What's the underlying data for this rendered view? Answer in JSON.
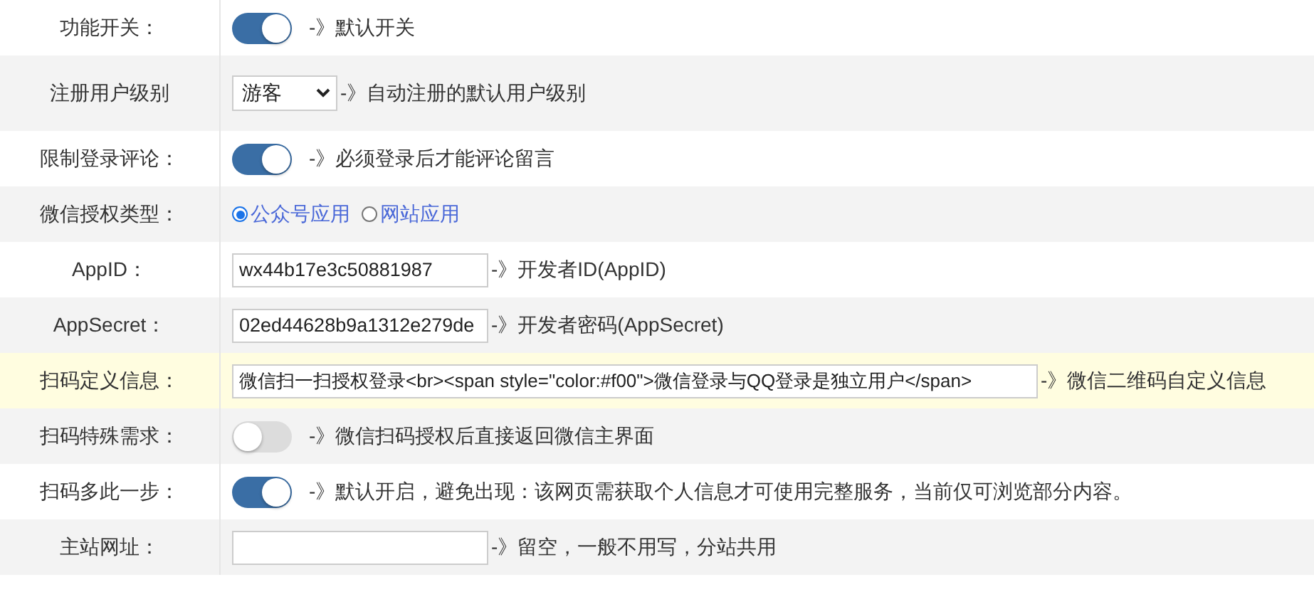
{
  "rows": [
    {
      "label": "功能开关：",
      "kind": "toggle",
      "on": true,
      "hint": "-》默认开关",
      "highlighted": false
    },
    {
      "label": "注册用户级别",
      "kind": "select",
      "value": "游客",
      "hint": "-》自动注册的默认用户级别",
      "highlighted": false
    },
    {
      "label": "限制登录评论：",
      "kind": "toggle",
      "on": true,
      "hint": "-》必须登录后才能评论留言",
      "highlighted": false
    },
    {
      "label": "微信授权类型：",
      "kind": "radio",
      "options": [
        {
          "label": "公众号应用",
          "selected": true
        },
        {
          "label": "网站应用",
          "selected": false
        }
      ],
      "highlighted": false
    },
    {
      "label": "AppID：",
      "kind": "text",
      "value": "wx44b17e3c50881987",
      "hint": "-》开发者ID(AppID)",
      "highlighted": false
    },
    {
      "label": "AppSecret：",
      "kind": "text",
      "value": "02ed44628b9a1312e279de",
      "hint": "-》开发者密码(AppSecret)",
      "highlighted": false
    },
    {
      "label": "扫码定义信息：",
      "kind": "wide-text",
      "value": "微信扫一扫授权登录<br><span style=\"color:#f00\">微信登录与QQ登录是独立用户</span>",
      "hint": "-》微信二维码自定义信息",
      "highlighted": true
    },
    {
      "label": "扫码特殊需求：",
      "kind": "toggle",
      "on": false,
      "hint": "-》微信扫码授权后直接返回微信主界面",
      "highlighted": false
    },
    {
      "label": "扫码多此一步：",
      "kind": "toggle",
      "on": true,
      "hint": "-》默认开启，避免出现：该网页需获取个人信息才可使用完整服务，当前仅可浏览部分内容。",
      "highlighted": false
    },
    {
      "label": "主站网址：",
      "kind": "text",
      "value": "",
      "hint": "-》留空，一般不用写，分站共用",
      "highlighted": false
    }
  ]
}
